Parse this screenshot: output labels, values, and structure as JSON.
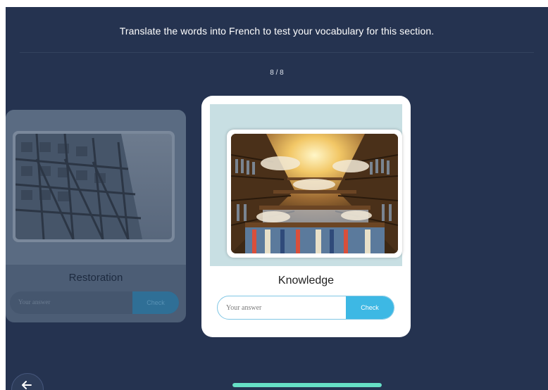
{
  "header": {
    "instruction": "Translate the words into French to test your vocabulary for this section.",
    "counter": "8 / 8"
  },
  "previous_card": {
    "word": "Restoration",
    "answer_placeholder": "Your answer",
    "check_label": "Check",
    "image_icon": "building-scaffold-photo"
  },
  "current_card": {
    "word": "Knowledge",
    "answer_placeholder": "Your answer",
    "check_label": "Check",
    "image_icon": "library-bookshelves-clouds-photo"
  },
  "navigation": {
    "back_icon": "arrow-left-icon",
    "progress_fraction": 1.0
  },
  "colors": {
    "background": "#253350",
    "accent": "#3db8e4",
    "progress": "#66e0c6",
    "image_panel": "#c8dfe3"
  }
}
